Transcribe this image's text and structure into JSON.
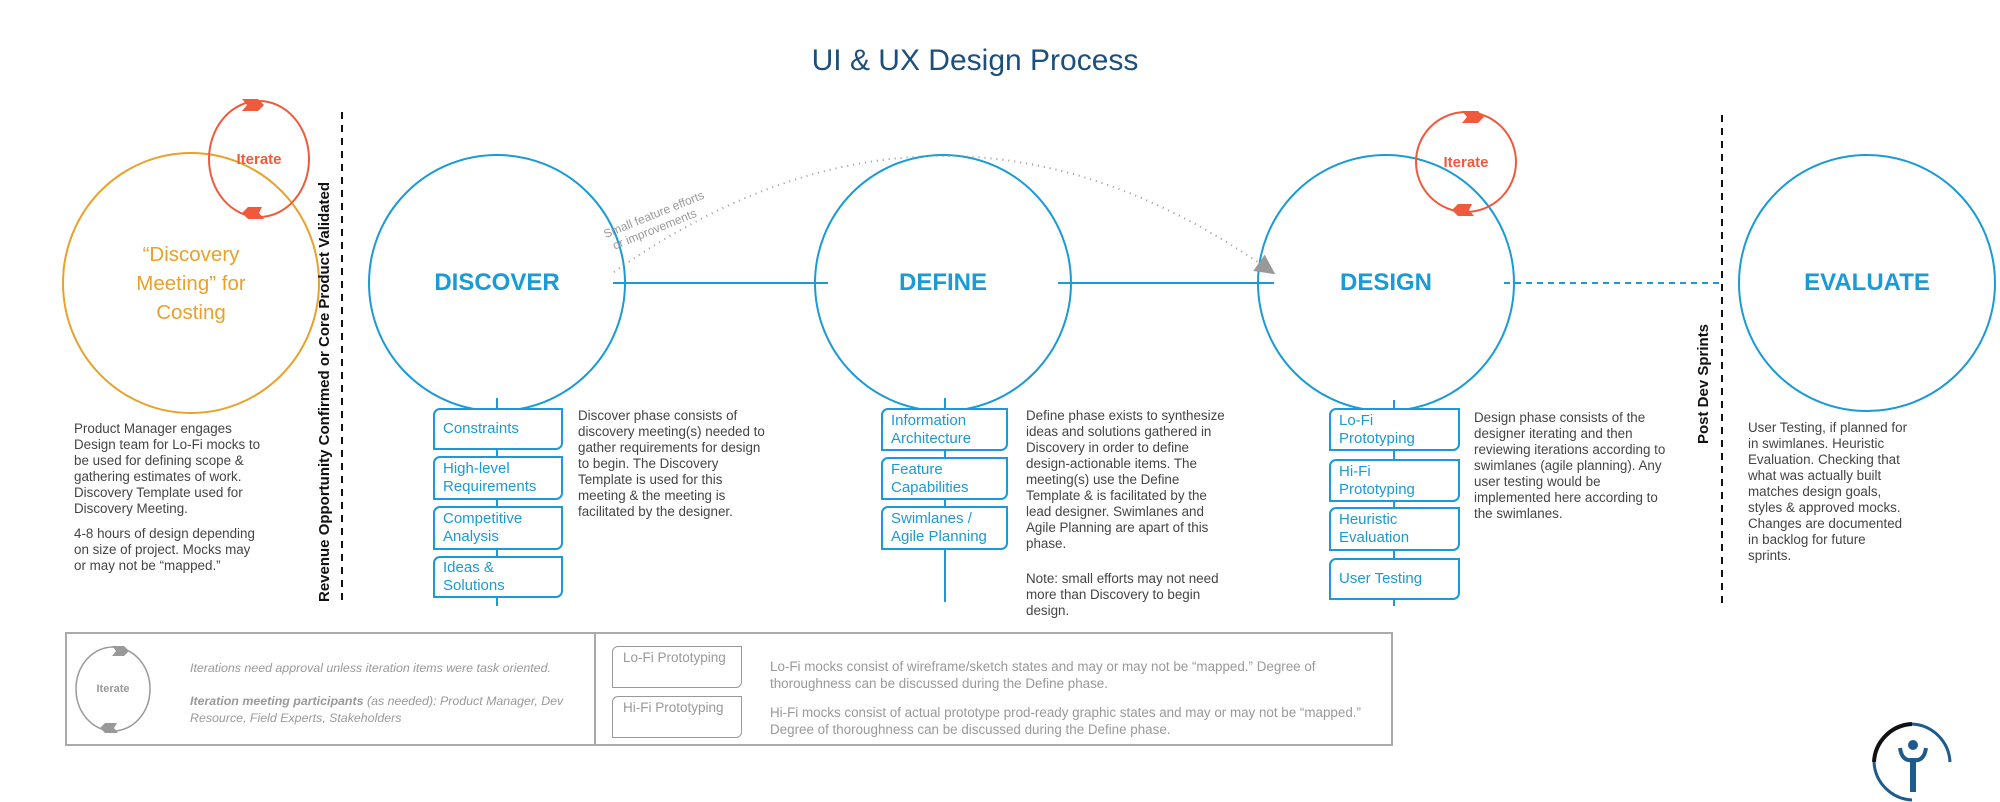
{
  "title": "UI & UX Design Process",
  "colors": {
    "blue": "#1a9ad6",
    "orange": "#e8a12a",
    "red": "#ef5a3c",
    "title": "#1d4f7c",
    "gray": "#999999"
  },
  "costing": {
    "circle_label": "“Discovery Meeting” for Costing",
    "iterate_label": "Iterate",
    "description_1": "Product Manager engages Design team for Lo-Fi mocks to be used for defining scope & gathering estimates of work. Discovery Template used for Discovery Meeting.",
    "description_2": "4-8 hours of design depending on size of project.  Mocks may or may not be “mapped.”"
  },
  "gate_left": "Revenue Opportunity Confirmed or Core Product Validated",
  "gate_right": "Post Dev Sprints",
  "shortcut_label_1": "Small feature efforts",
  "shortcut_label_2": "or improvements",
  "phases": {
    "discover": {
      "label": "DISCOVER",
      "items": [
        "Constraints",
        "High-level Requirements",
        "Competitive Analysis",
        "Ideas & Solutions"
      ],
      "description": "Discover phase consists of discovery meeting(s) needed to gather requirements for design to begin.  The Discovery Template is used for this meeting & the meeting is facilitated by the designer."
    },
    "define": {
      "label": "DEFINE",
      "items": [
        "Information Architecture",
        "Feature Capabilities",
        "Swimlanes / Agile Planning"
      ],
      "description": "Define phase exists to synthesize ideas and solutions gathered in Discovery in order to define design-actionable items. The meeting(s) use the Define Template & is facilitated by the lead designer.  Swimlanes and Agile Planning are apart of this phase.",
      "note": "Note: small efforts may not need more than Discovery to begin design."
    },
    "design": {
      "label": "DESIGN",
      "iterate_label": "Iterate",
      "items": [
        "Lo-Fi Prototyping",
        "Hi-Fi Prototyping",
        "Heuristic Evaluation",
        "User Testing"
      ],
      "description": "Design phase consists of the designer iterating and then reviewing iterations according to swimlanes (agile planning).  Any user testing would be implemented here according to the swimlanes."
    },
    "evaluate": {
      "label": "EVALUATE",
      "description": "User Testing, if planned for in swimlanes. Heuristic Evaluation.  Checking that what was actually built matches design goals, styles & approved mocks. Changes are documented in backlog for future sprints."
    }
  },
  "legend": {
    "iterate_label": "Iterate",
    "approval_note": "Iterations need approval unless iteration items were task oriented.",
    "participants_bold": "Iteration meeting participants",
    "participants_rest": " (as needed): Product Manager, Dev Resource, Field Experts, Stakeholders",
    "lofi_box": "Lo-Fi Prototyping",
    "lofi_text": "Lo-Fi mocks consist of wireframe/sketch states and may or may not be “mapped.”  Degree of thoroughness can be discussed during the Define phase.",
    "hifi_box": "Hi-Fi Prototyping",
    "hifi_text": "Hi-Fi mocks consist of actual prototype prod-ready graphic states and may or may not be “mapped.”  Degree of thoroughness can be discussed during the Define phase."
  }
}
